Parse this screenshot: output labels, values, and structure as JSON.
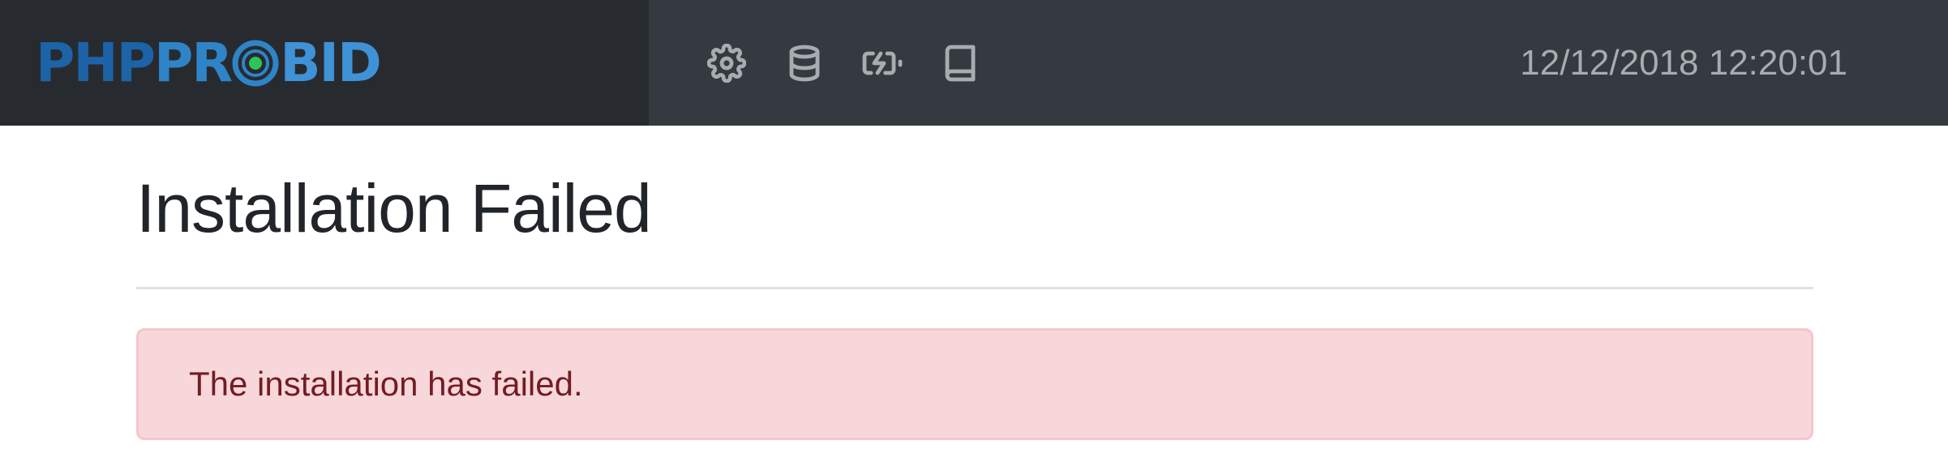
{
  "brand": {
    "logo_part_1": "PHP",
    "logo_part_2": "PR",
    "logo_part_3": "BID",
    "colors": {
      "dark_blue": "#1c63a8",
      "mid_blue": "#2f84c8",
      "light_blue": "#3f92d6",
      "target_dot": "#2ec45a"
    }
  },
  "navbar": {
    "icons": [
      {
        "name": "gear-icon"
      },
      {
        "name": "database-icon"
      },
      {
        "name": "battery-charging-icon"
      },
      {
        "name": "book-icon"
      }
    ],
    "datetime": "12/12/2018 12:20:01",
    "colors": {
      "background": "#343a40",
      "brand_background": "#272b30"
    }
  },
  "main": {
    "title": "Installation Failed",
    "alert": {
      "type": "danger",
      "text": "The installation has failed.",
      "colors": {
        "background": "#f8d7da",
        "border": "#f5c6cb",
        "text": "#721c24"
      }
    }
  }
}
